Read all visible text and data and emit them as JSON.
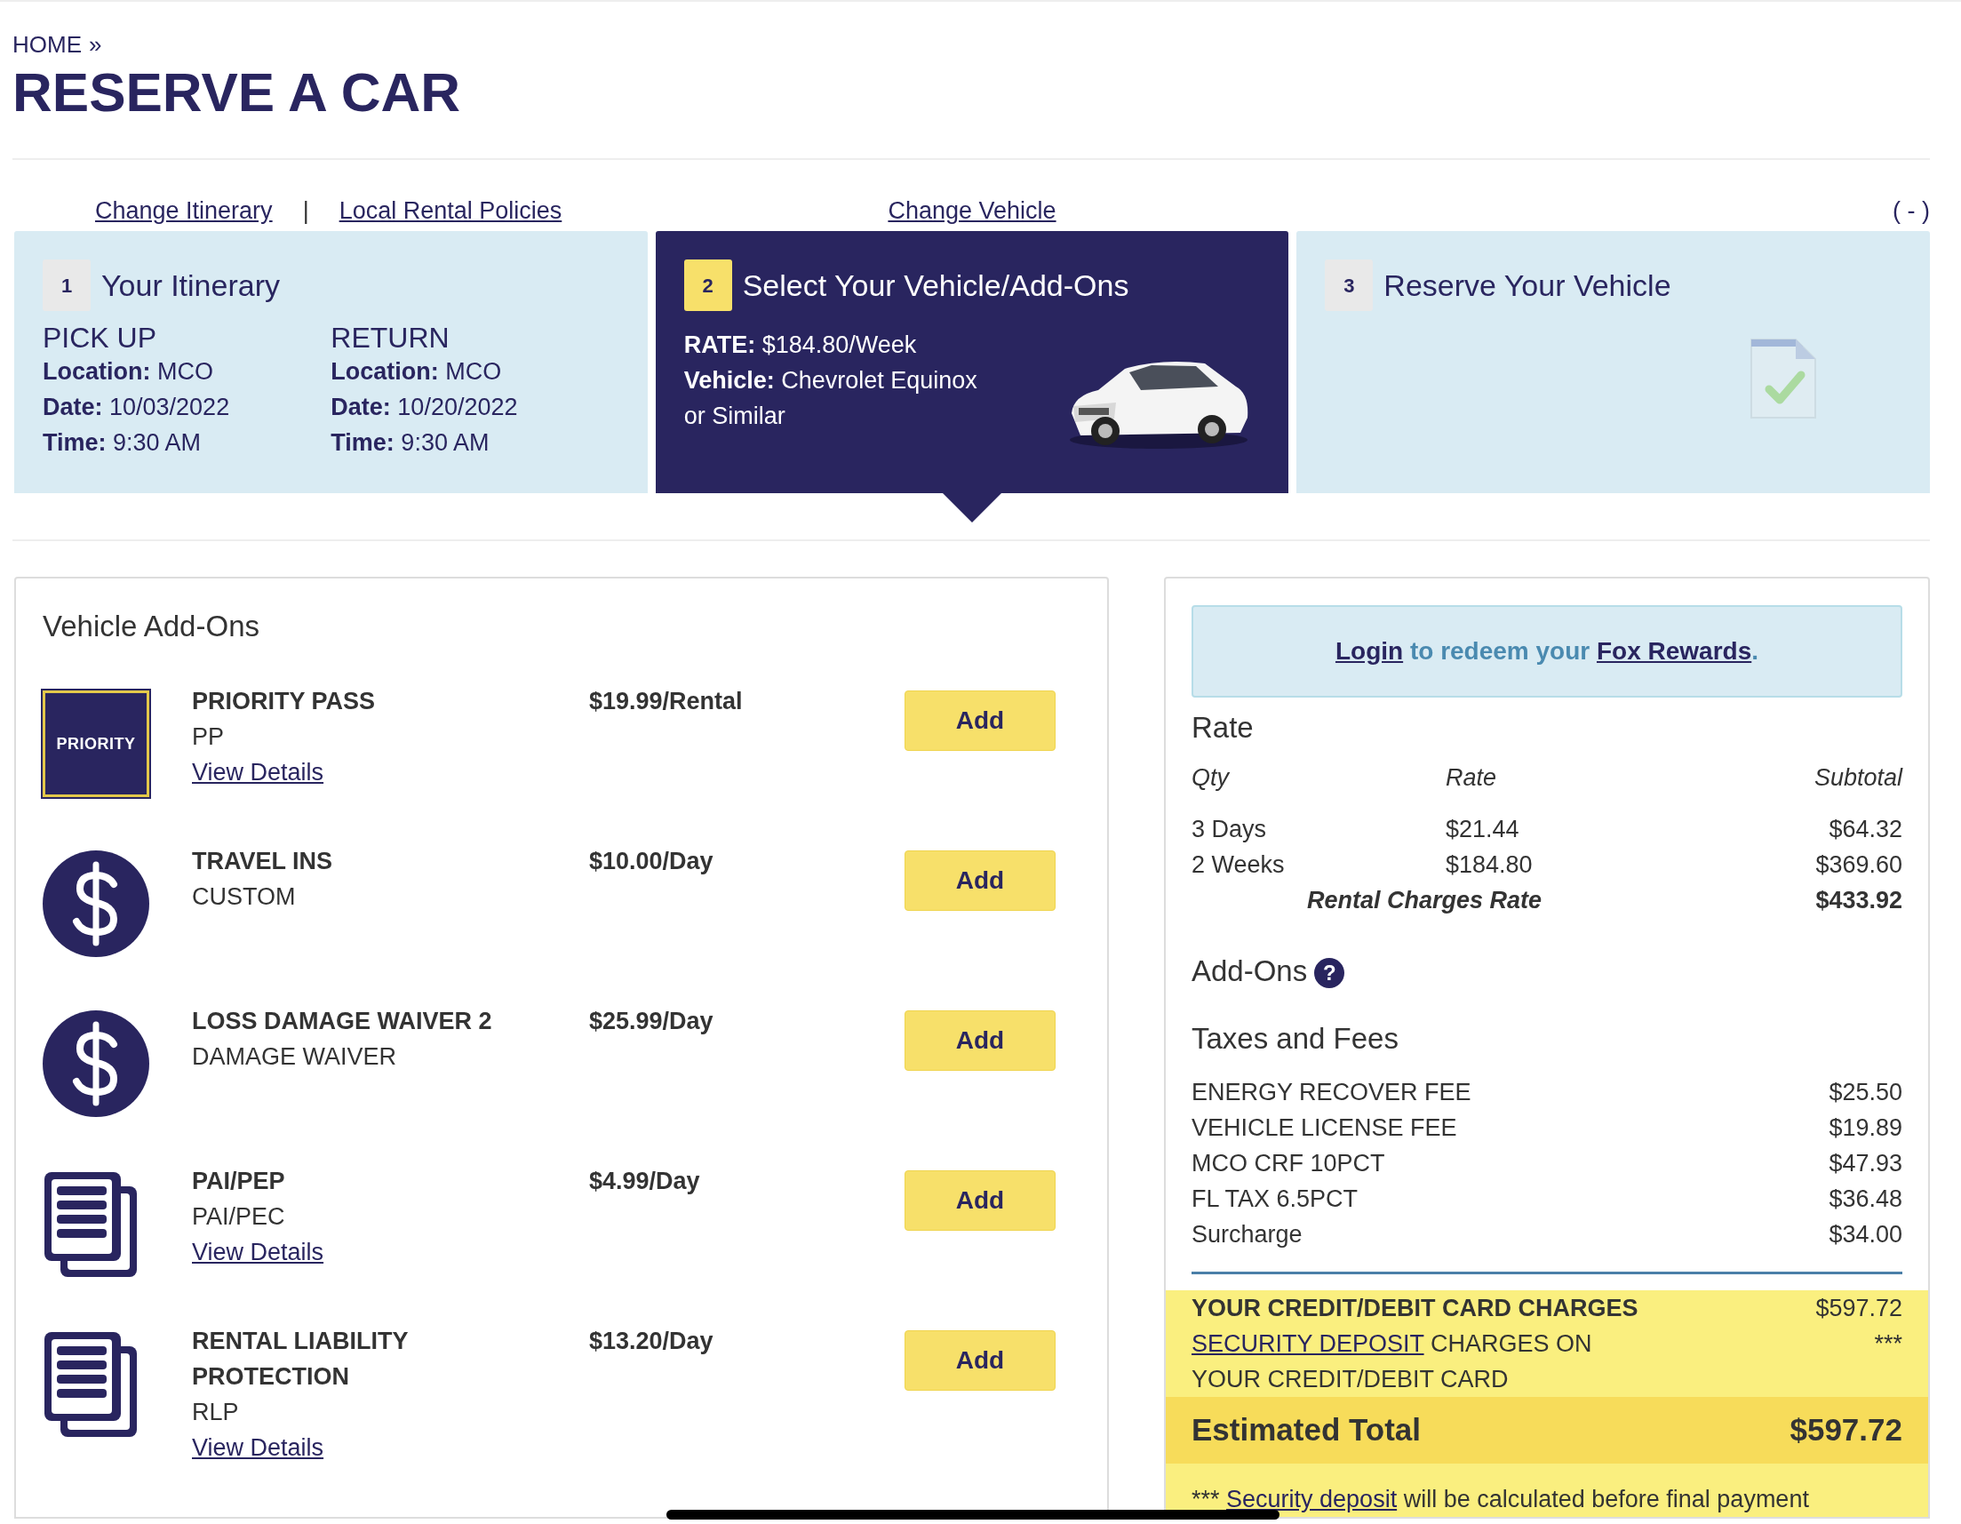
{
  "breadcrumb": {
    "label": "HOME",
    "separator": "»"
  },
  "page_title": "RESERVE A CAR",
  "nav": {
    "left_links": [
      "Change Itinerary",
      "Local Rental Policies"
    ],
    "separator": "|",
    "center_link": "Change Vehicle",
    "collapse_toggle": "( - )"
  },
  "steps": [
    {
      "number": "1",
      "title": "Your Itinerary",
      "selected": false,
      "kind": "itinerary",
      "columns": [
        {
          "heading": "PICK UP",
          "fields": [
            {
              "label": "Location:",
              "value": "MCO"
            },
            {
              "label": "Date:",
              "value": "10/03/2022"
            },
            {
              "label": "Time:",
              "value": "9:30 AM"
            }
          ]
        },
        {
          "heading": "RETURN",
          "fields": [
            {
              "label": "Location:",
              "value": "MCO"
            },
            {
              "label": "Date:",
              "value": "10/20/2022"
            },
            {
              "label": "Time:",
              "value": "9:30 AM"
            }
          ]
        }
      ]
    },
    {
      "number": "2",
      "title": "Select Your Vehicle/Add-Ons",
      "selected": true,
      "kind": "vehicle",
      "fields": [
        {
          "label": "RATE:",
          "value": "$184.80/Week"
        },
        {
          "label": "Vehicle:",
          "value": "Chevrolet Equinox or Similar"
        }
      ]
    },
    {
      "number": "3",
      "title": "Reserve Your Vehicle",
      "selected": false,
      "kind": "confirm"
    }
  ],
  "addons": {
    "heading": "Vehicle Add-Ons",
    "items": [
      {
        "kind": "logo",
        "logo_text": "PRIORITY",
        "name": "PRIORITY PASS",
        "code": "PP",
        "details_link": "View Details",
        "price": "$19.99/Rental",
        "button": "Add"
      },
      {
        "kind": "coverage",
        "name": "TRAVEL INS",
        "code": "CUSTOM",
        "price": "$10.00/Day",
        "button": "Add"
      },
      {
        "kind": "coverage",
        "name": "LOSS DAMAGE WAIVER 2",
        "code": "DAMAGE WAIVER",
        "price": "$25.99/Day",
        "button": "Add"
      },
      {
        "kind": "document",
        "name": "PAI/PEP",
        "code": "PAI/PEC",
        "details_link": "View Details",
        "price": "$4.99/Day",
        "button": "Add"
      },
      {
        "kind": "document",
        "name": "RENTAL LIABILITY PROTECTION",
        "code": "RLP",
        "details_link": "View Details",
        "price": "$13.20/Day",
        "button": "Add"
      }
    ]
  },
  "summary": {
    "rewards_banner": {
      "login_link": "Login",
      "text": "to redeem your",
      "rewards_link": "Fox Rewards",
      "end": "."
    },
    "rate": {
      "heading": "Rate",
      "columns": [
        "Qty",
        "Rate",
        "Subtotal"
      ],
      "rows": [
        {
          "qty": "3 Days",
          "rate": "$21.44",
          "subtotal": "$64.32"
        },
        {
          "qty": "2 Weeks",
          "rate": "$184.80",
          "subtotal": "$369.60"
        }
      ],
      "total_label": "Rental Charges Rate",
      "total": "$433.92"
    },
    "addons_heading": "Add-Ons",
    "help_icon": "?",
    "taxes": {
      "heading": "Taxes and Fees",
      "rows": [
        {
          "label": "ENERGY RECOVER FEE",
          "amount": "$25.50"
        },
        {
          "label": "VEHICLE LICENSE FEE",
          "amount": "$19.89"
        },
        {
          "label": "MCO CRF 10PCT",
          "amount": "$47.93"
        },
        {
          "label": "FL TAX 6.5PCT",
          "amount": "$36.48"
        },
        {
          "label": "Surcharge",
          "amount": "$34.00"
        }
      ]
    },
    "card_charges": {
      "label": "YOUR CREDIT/DEBIT CARD CHARGES",
      "amount": "$597.72"
    },
    "deposit": {
      "link": "SECURITY DEPOSIT",
      "text": "CHARGES ON YOUR CREDIT/DEBIT CARD",
      "amount": "***"
    },
    "estimated_total": {
      "label": "Estimated Total",
      "amount": "$597.72"
    },
    "footnote": {
      "prefix": "***",
      "link": "Security deposit",
      "text": "will be calculated before final payment"
    }
  }
}
